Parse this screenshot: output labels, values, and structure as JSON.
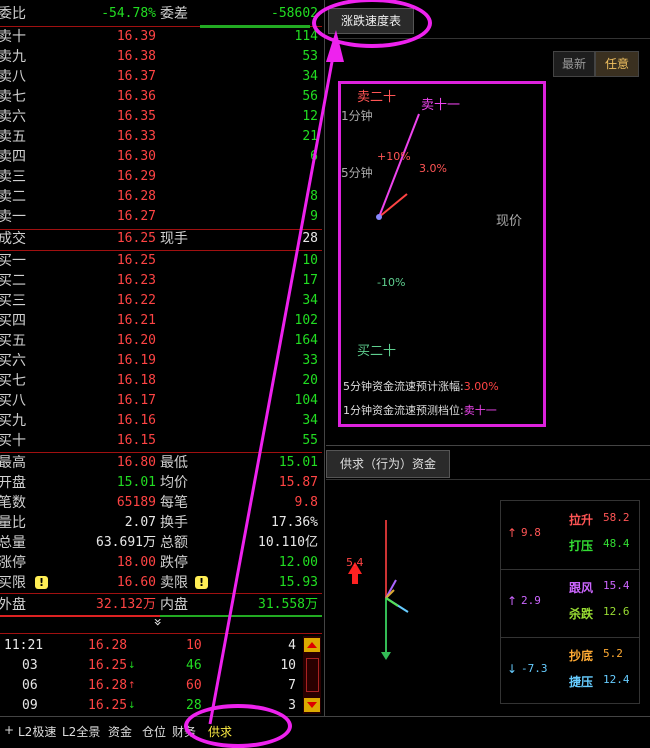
{
  "commission": {
    "ratio_label": "委比",
    "ratio_value": "-54.78%",
    "diff_label": "委差",
    "diff_value": "-58602"
  },
  "sells": [
    {
      "label": "卖十",
      "price": "16.39",
      "vol": "114"
    },
    {
      "label": "卖九",
      "price": "16.38",
      "vol": "53"
    },
    {
      "label": "卖八",
      "price": "16.37",
      "vol": "34"
    },
    {
      "label": "卖七",
      "price": "16.36",
      "vol": "56"
    },
    {
      "label": "卖六",
      "price": "16.35",
      "vol": "12"
    },
    {
      "label": "卖五",
      "price": "16.33",
      "vol": "21"
    },
    {
      "label": "卖四",
      "price": "16.30",
      "vol": "6"
    },
    {
      "label": "卖三",
      "price": "16.29",
      "vol": ""
    },
    {
      "label": "卖二",
      "price": "16.28",
      "vol": "8"
    },
    {
      "label": "卖一",
      "price": "16.27",
      "vol": "9"
    }
  ],
  "deal": {
    "label": "成交",
    "price": "16.25",
    "hand_label": "现手",
    "hand_value": "28"
  },
  "buys": [
    {
      "label": "买一",
      "price": "16.25",
      "vol": "10"
    },
    {
      "label": "买二",
      "price": "16.23",
      "vol": "17"
    },
    {
      "label": "买三",
      "price": "16.22",
      "vol": "34"
    },
    {
      "label": "买四",
      "price": "16.21",
      "vol": "102"
    },
    {
      "label": "买五",
      "price": "16.20",
      "vol": "164"
    },
    {
      "label": "买六",
      "price": "16.19",
      "vol": "33"
    },
    {
      "label": "买七",
      "price": "16.18",
      "vol": "20"
    },
    {
      "label": "买八",
      "price": "16.17",
      "vol": "104"
    },
    {
      "label": "买九",
      "price": "16.16",
      "vol": "34"
    },
    {
      "label": "买十",
      "price": "16.15",
      "vol": "55"
    }
  ],
  "stats": [
    {
      "l1": "最高",
      "v1": "16.80",
      "c1": "red",
      "l2": "最低",
      "v2": "15.01",
      "c2": "green"
    },
    {
      "l1": "开盘",
      "v1": "15.01",
      "c1": "green",
      "l2": "均价",
      "v2": "15.87",
      "c2": "red"
    },
    {
      "l1": "笔数",
      "v1": "65189",
      "c1": "red",
      "l2": "每笔",
      "v2": "9.8",
      "c2": "red"
    },
    {
      "l1": "量比",
      "v1": "2.07",
      "c1": "white",
      "l2": "换手",
      "v2": "17.36%",
      "c2": "white"
    },
    {
      "l1": "总量",
      "v1": "63.691万",
      "c1": "white",
      "l2": "总额",
      "v2": "10.110亿",
      "c2": "white"
    },
    {
      "l1": "涨停",
      "v1": "18.00",
      "c1": "red",
      "l2": "跌停",
      "v2": "12.00",
      "c2": "green"
    },
    {
      "l1": "买限",
      "v1": "16.60",
      "c1": "red",
      "l2": "卖限",
      "v2": "15.93",
      "c2": "green"
    }
  ],
  "outer": {
    "out_label": "外盘",
    "out_value": "32.132万",
    "in_label": "内盘",
    "in_value": "31.558万"
  },
  "expand_glyph": "»",
  "ticks": [
    {
      "time": "11:21",
      "price": "16.28",
      "arrow": "",
      "pc": "red",
      "vol": "10",
      "vc": "red",
      "n": "4"
    },
    {
      "time": "03",
      "price": "16.25",
      "arrow": "↓",
      "pc": "red",
      "vol": "46",
      "vc": "green",
      "n": "10"
    },
    {
      "time": "06",
      "price": "16.28",
      "arrow": "↑",
      "pc": "red",
      "vol": "60",
      "vc": "red",
      "n": "7"
    },
    {
      "time": "09",
      "price": "16.25",
      "arrow": "↓",
      "pc": "red",
      "vol": "28",
      "vc": "green",
      "n": "3"
    }
  ],
  "bottom_tabs": [
    "+",
    "L2极速",
    "L2全景",
    "资金",
    "仓位",
    "财务",
    "供求"
  ],
  "speed_panel": {
    "tab_label": "涨跌速度表",
    "mode_buttons": [
      "最新",
      "任意"
    ],
    "labels": {
      "sell20": "卖二十",
      "sell11": "卖十一",
      "min1": "1分钟",
      "min5": "5分钟",
      "plus10": "+10%",
      "pct3": "3.0%",
      "current": "现价",
      "minus10": "-10%",
      "buy20": "买二十"
    },
    "line1_label": "5分钟资金流速预计涨幅:",
    "line1_value": "3.00%",
    "line2_label": "1分钟资金流速预测档位:",
    "line2_value": "卖十一"
  },
  "supply_panel": {
    "tab_label": "供求（行为）资金",
    "arrow_value": "5.4",
    "groups": [
      {
        "arrow": "↑",
        "value": "9.8",
        "color": "#ff5555",
        "items": [
          {
            "name": "拉升",
            "val": "58.2",
            "color": "#ff5555"
          },
          {
            "name": "打压",
            "val": "48.4",
            "color": "#33dd33"
          }
        ]
      },
      {
        "arrow": "↑",
        "value": "2.9",
        "color": "#cc66ff",
        "items": [
          {
            "name": "跟风",
            "val": "15.4",
            "color": "#cc66ff"
          },
          {
            "name": "杀跌",
            "val": "12.6",
            "color": "#99dd33"
          }
        ]
      },
      {
        "arrow": "↓",
        "value": "-7.3",
        "color": "#66ccff",
        "items": [
          {
            "name": "抄底",
            "val": "5.2",
            "color": "#ffaa33"
          },
          {
            "name": "捷压",
            "val": "12.4",
            "color": "#66ccff"
          }
        ]
      }
    ]
  },
  "colors": {
    "annotation": "#ee22ee",
    "accent_red": "#ff4444",
    "accent_green": "#22dd22"
  }
}
